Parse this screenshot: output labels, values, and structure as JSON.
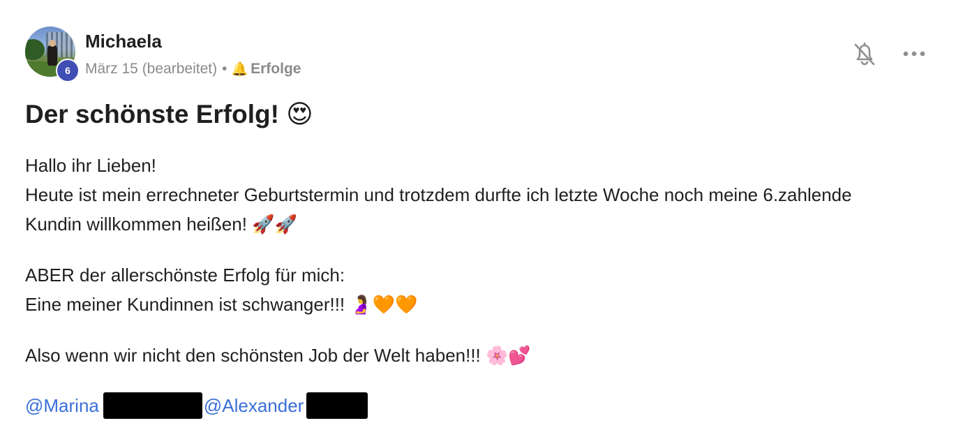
{
  "post": {
    "author": {
      "name": "Michaela",
      "level": "6"
    },
    "meta": {
      "date": "März 15 (bearbeitet)",
      "separator": "•",
      "category_icon": "🔔",
      "category": "Erfolge"
    },
    "actions": {
      "bell_icon": "bell-off-icon",
      "more_icon": "more-horizontal-icon"
    },
    "title": "Der schönste Erfolg! 😍",
    "paragraphs": [
      "Hallo ihr Lieben!\nHeute ist mein errechneter Geburtstermin und trotzdem durfte ich letzte Woche noch meine 6.zahlende Kundin willkommen heißen! 🚀🚀",
      "ABER der allerschönste Erfolg für mich:\nEine meiner Kundinnen ist schwanger!!! 🤰🧡🧡",
      "Also wenn wir nicht den schönsten Job der Welt haben!!! 🌸💕"
    ],
    "mentions": [
      "@Marina",
      "@Alexander"
    ]
  },
  "colors": {
    "mention": "#3a6fd8",
    "level_badge": "#3f4fb3",
    "meta_text": "#8a8a8a",
    "redaction": "#000000"
  }
}
